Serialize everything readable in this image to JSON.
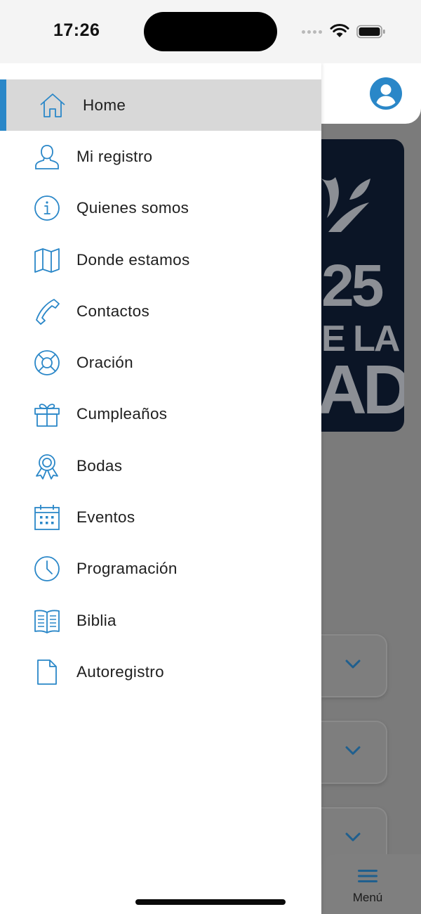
{
  "status_bar": {
    "time": "17:26"
  },
  "drawer": {
    "items": [
      {
        "label": "Home",
        "icon": "home-icon",
        "active": true
      },
      {
        "label": "Mi registro",
        "icon": "user-icon"
      },
      {
        "label": "Quienes somos",
        "icon": "info-icon"
      },
      {
        "label": "Donde estamos",
        "icon": "map-icon"
      },
      {
        "label": "Contactos",
        "icon": "phone-icon"
      },
      {
        "label": "Oración",
        "icon": "lifebuoy-icon"
      },
      {
        "label": "Cumpleaños",
        "icon": "gift-icon"
      },
      {
        "label": "Bodas",
        "icon": "award-ribbon-icon"
      },
      {
        "label": "Eventos",
        "icon": "calendar-icon"
      },
      {
        "label": "Programación",
        "icon": "clock-icon"
      },
      {
        "label": "Biblia",
        "icon": "book-icon"
      },
      {
        "label": "Autoregistro",
        "icon": "document-icon"
      }
    ]
  },
  "background": {
    "banner": {
      "line1": "25",
      "line2": "E LA",
      "line3": "AD"
    },
    "tabbar": {
      "menu_label": "Menú"
    }
  },
  "colors": {
    "accent": "#2a87c8",
    "active_row": "#d8d8d8",
    "overlay": "#7b7b7b",
    "banner": "#0b1526"
  }
}
